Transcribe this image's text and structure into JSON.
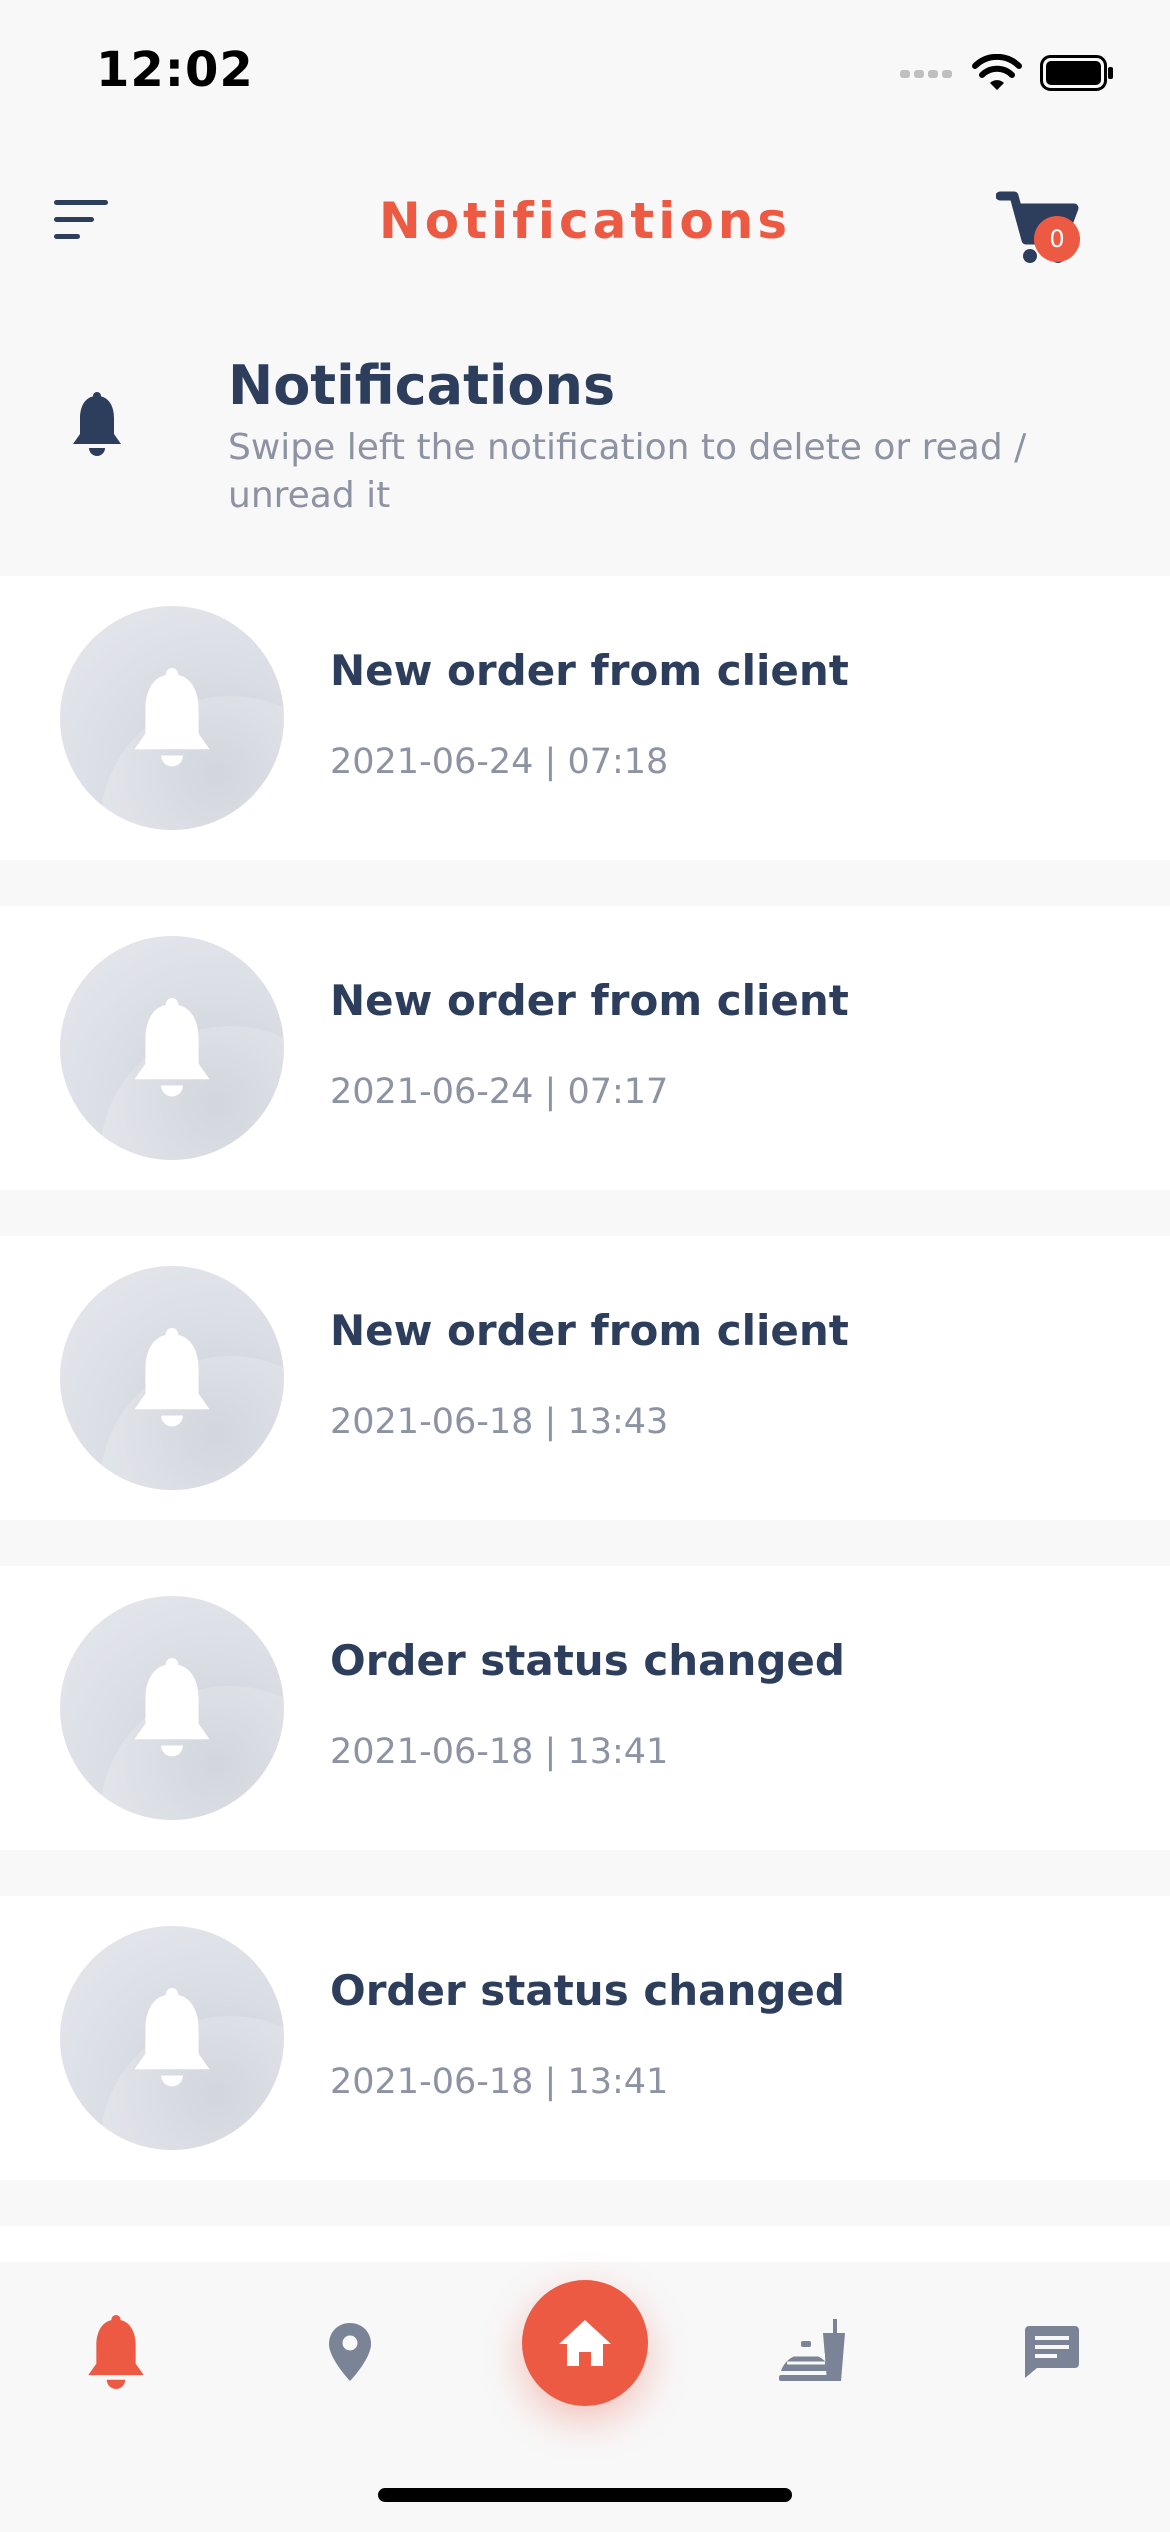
{
  "status": {
    "time": "12:02"
  },
  "header": {
    "title": "Notifications",
    "cart_count": "0"
  },
  "section": {
    "title": "Notifications",
    "subtitle": "Swipe left the notification to delete or read / unread it"
  },
  "notifications": [
    {
      "title": "New order from client",
      "time": "2021-06-24 | 07:18"
    },
    {
      "title": "New order from client",
      "time": "2021-06-24 | 07:17"
    },
    {
      "title": "New order from client",
      "time": "2021-06-18 | 13:43"
    },
    {
      "title": "Order status changed",
      "time": "2021-06-18 | 13:41"
    },
    {
      "title": "Order status changed",
      "time": "2021-06-18 | 13:41"
    }
  ],
  "nav": {
    "items": [
      "bell-icon",
      "location-pin-icon",
      "home-icon",
      "food-icon",
      "chat-icon"
    ],
    "active": "bell-icon"
  },
  "colors": {
    "accent": "#ec5a44",
    "text": "#2d3d5c",
    "muted": "#8d93a3",
    "inactive_icon": "#7b8497"
  }
}
